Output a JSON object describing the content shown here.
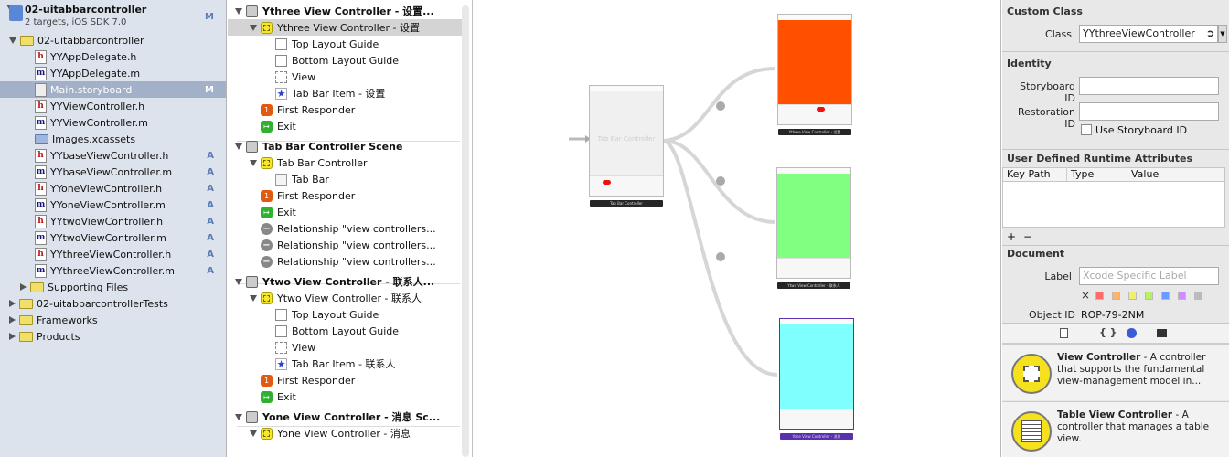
{
  "navigator": {
    "project": {
      "name": "02-uitabbarcontroller",
      "subtitle": "2 targets, iOS SDK 7.0",
      "badge": "M"
    },
    "items": [
      {
        "label": "02-uitabbarcontroller",
        "kind": "folder",
        "badge": ""
      },
      {
        "label": "YYAppDelegate.h",
        "kind": "h",
        "badge": ""
      },
      {
        "label": "YYAppDelegate.m",
        "kind": "m",
        "badge": ""
      },
      {
        "label": "Main.storyboard",
        "kind": "storyboard",
        "badge": "M"
      },
      {
        "label": "YYViewController.h",
        "kind": "h",
        "badge": ""
      },
      {
        "label": "YYViewController.m",
        "kind": "m",
        "badge": ""
      },
      {
        "label": "Images.xcassets",
        "kind": "assets",
        "badge": ""
      },
      {
        "label": "YYbaseViewController.h",
        "kind": "h",
        "badge": "A"
      },
      {
        "label": "YYbaseViewController.m",
        "kind": "m",
        "badge": "A"
      },
      {
        "label": "YYoneViewController.h",
        "kind": "h",
        "badge": "A"
      },
      {
        "label": "YYoneViewController.m",
        "kind": "m",
        "badge": "A"
      },
      {
        "label": "YYtwoViewController.h",
        "kind": "h",
        "badge": "A"
      },
      {
        "label": "YYtwoViewController.m",
        "kind": "m",
        "badge": "A"
      },
      {
        "label": "YYthreeViewController.h",
        "kind": "h",
        "badge": "A"
      },
      {
        "label": "YYthreeViewController.m",
        "kind": "m",
        "badge": "A"
      },
      {
        "label": "Supporting Files",
        "kind": "folder",
        "badge": ""
      },
      {
        "label": "02-uitabbarcontrollerTests",
        "kind": "folder",
        "badge": ""
      },
      {
        "label": "Frameworks",
        "kind": "folder",
        "badge": ""
      },
      {
        "label": "Products",
        "kind": "folder",
        "badge": ""
      }
    ]
  },
  "outline": {
    "rows": [
      {
        "label": "Ythree View Controller - 设置...",
        "icon": "scene"
      },
      {
        "label": "Ythree View Controller - 设置",
        "icon": "vc"
      },
      {
        "label": "Top Layout Guide",
        "icon": "guide"
      },
      {
        "label": "Bottom Layout Guide",
        "icon": "guide"
      },
      {
        "label": "View",
        "icon": "view"
      },
      {
        "label": "Tab Bar Item - 设置",
        "icon": "star"
      },
      {
        "label": "First Responder",
        "icon": "resp"
      },
      {
        "label": "Exit",
        "icon": "exit"
      },
      {
        "label": "Tab Bar Controller Scene",
        "icon": "scene"
      },
      {
        "label": "Tab Bar Controller",
        "icon": "vc"
      },
      {
        "label": "Tab Bar",
        "icon": "tbar"
      },
      {
        "label": "First Responder",
        "icon": "resp"
      },
      {
        "label": "Exit",
        "icon": "exit"
      },
      {
        "label": "Relationship \"view controllers...",
        "icon": "rel"
      },
      {
        "label": "Relationship \"view controllers...",
        "icon": "rel"
      },
      {
        "label": "Relationship \"view controllers...",
        "icon": "rel"
      },
      {
        "label": "Ytwo View Controller - 联系人...",
        "icon": "scene"
      },
      {
        "label": "Ytwo View Controller - 联系人",
        "icon": "vc"
      },
      {
        "label": "Top Layout Guide",
        "icon": "guide"
      },
      {
        "label": "Bottom Layout Guide",
        "icon": "guide"
      },
      {
        "label": "View",
        "icon": "view"
      },
      {
        "label": "Tab Bar Item - 联系人",
        "icon": "star"
      },
      {
        "label": "First Responder",
        "icon": "resp"
      },
      {
        "label": "Exit",
        "icon": "exit"
      },
      {
        "label": "Yone View Controller - 消息 Sc...",
        "icon": "scene"
      },
      {
        "label": "Yone View Controller - 消息",
        "icon": "vc"
      }
    ]
  },
  "canvas": {
    "tabbar_controller": {
      "title": "Tab Bar Controller",
      "caption": "Tab Bar Controller"
    },
    "screens": [
      {
        "caption": "Ythree View Controller - 设置",
        "color": "#ff5000"
      },
      {
        "caption": "Ytwo View Controller - 联系人",
        "color": "#80ff80"
      },
      {
        "caption": "Yone View Controller - 消息",
        "color": "#80ffff"
      }
    ]
  },
  "inspector": {
    "custom_class": {
      "header": "Custom Class",
      "class_label": "Class",
      "class_value": "YYthreeViewController"
    },
    "identity": {
      "header": "Identity",
      "storyboard_id_label": "Storyboard ID",
      "restoration_id_label": "Restoration ID",
      "use_storyboard_id_label": "Use Storyboard ID"
    },
    "runtime_attributes": {
      "header": "User Defined Runtime Attributes",
      "columns": [
        "Key Path",
        "Type",
        "Value"
      ],
      "add": "+",
      "remove": "−"
    },
    "document": {
      "header": "Document",
      "label_label": "Label",
      "label_placeholder": "Xcode Specific Label",
      "object_id_label": "Object ID",
      "object_id_value": "ROP-79-2NM"
    },
    "library_tabs": [
      "file-template",
      "code-snippet",
      "object",
      "media"
    ],
    "library": [
      {
        "title": "View Controller",
        "desc": " - A controller that supports the fundamental view-management model in..."
      },
      {
        "title": "Table View Controller",
        "desc": " - A controller that manages a table view."
      }
    ],
    "colors": [
      "#ff6b6b",
      "#ffb36b",
      "#f0f06b",
      "#b8f06b",
      "#6b9bff",
      "#d28bff",
      "#bbbbbb"
    ]
  }
}
